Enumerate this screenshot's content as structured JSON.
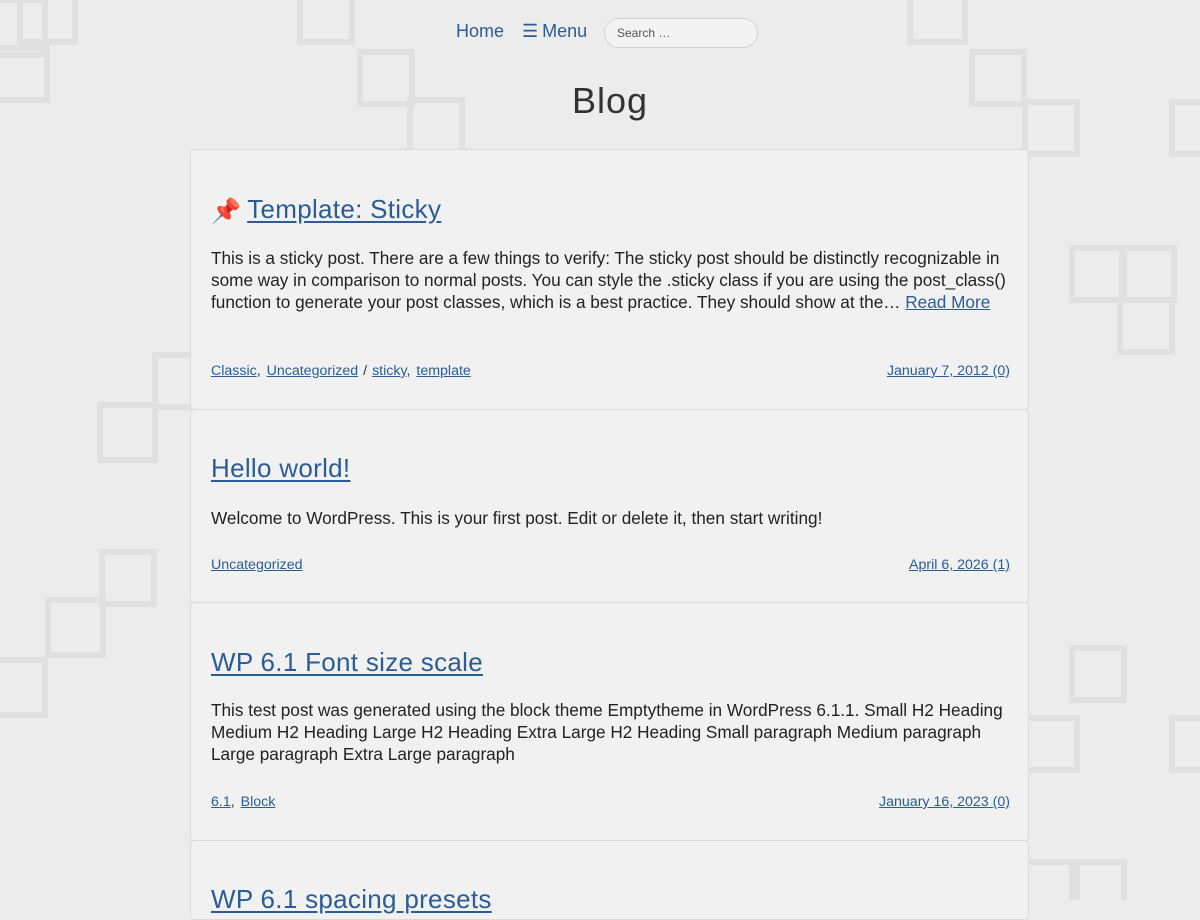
{
  "nav": {
    "home_label": "Home",
    "menu_glyph": "☰",
    "menu_label": "Menu",
    "search_placeholder": "Search …"
  },
  "page": {
    "title": "Blog"
  },
  "icons": {
    "pin": "📌"
  },
  "colors": {
    "link": "#2a5d95",
    "background": "#ececec",
    "card": "#f1f1f1"
  },
  "posts": [
    {
      "title": "Template: Sticky",
      "sticky": true,
      "excerpt": "This is a sticky post. There are a few things to verify: The sticky post should be distinctly recognizable in some way in comparison to normal posts. You can style the .sticky class if you are using the post_class() function to generate your post classes, which is a best practice. They should show at the…",
      "read_more": "Read More",
      "categories": [
        "Classic",
        "Uncategorized"
      ],
      "tag_separator": "/",
      "tags": [
        "sticky",
        "template"
      ],
      "date": "January 7, 2012",
      "comments": "(0)"
    },
    {
      "title": "Hello world!",
      "excerpt": "Welcome to WordPress. This is your first post. Edit or delete it, then start writing!",
      "categories": [
        "Uncategorized"
      ],
      "date": "April 6, 2026",
      "comments": "(1)"
    },
    {
      "title": "WP 6.1 Font size scale",
      "excerpt": "This test post was generated using the block theme Emptytheme in WordPress 6.1.1. Small H2 Heading Medium H2 Heading Large H2 Heading Extra Large H2 Heading Small paragraph Medium paragraph Large paragraph Extra Large paragraph",
      "categories": [
        "6.1",
        "Block"
      ],
      "date": "January 16, 2023",
      "comments": "(0)"
    },
    {
      "title": "WP 6.1 spacing presets"
    }
  ]
}
